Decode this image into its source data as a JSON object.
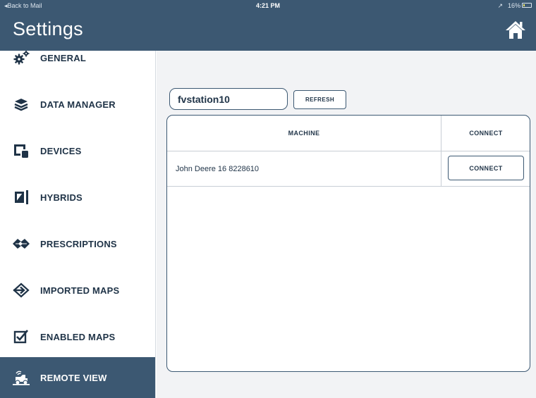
{
  "status_bar": {
    "back_label": "◂Back to Mail",
    "time": "4:21 PM",
    "battery": "↗   16%"
  },
  "header": {
    "title": "Settings",
    "home_icon": "home-icon"
  },
  "sidebar": {
    "items": [
      {
        "label": "GENERAL",
        "icon": "gears-icon"
      },
      {
        "label": "DATA MANAGER",
        "icon": "database-icon"
      },
      {
        "label": "DEVICES",
        "icon": "devices-icon"
      },
      {
        "label": "HYBRIDS",
        "icon": "hybrids-icon"
      },
      {
        "label": "PRESCRIPTIONS",
        "icon": "prescriptions-icon"
      },
      {
        "label": "IMPORTED MAPS",
        "icon": "import-arrow-icon"
      },
      {
        "label": "ENABLED MAPS",
        "icon": "checkbox-icon"
      },
      {
        "label": "REMOTE VIEW",
        "icon": "remote-view-icon",
        "active": true
      }
    ]
  },
  "main": {
    "search": {
      "value": "fvstation10"
    },
    "refresh_label": "REFRESH",
    "table": {
      "columns": [
        "MACHINE",
        "CONNECT"
      ],
      "rows": [
        {
          "machine": "John Deere  16 8228610",
          "action": "CONNECT"
        }
      ]
    }
  },
  "colors": {
    "header_bg": "#3c5872",
    "text": "#1f3347",
    "content_bg": "#f2f3f5"
  }
}
